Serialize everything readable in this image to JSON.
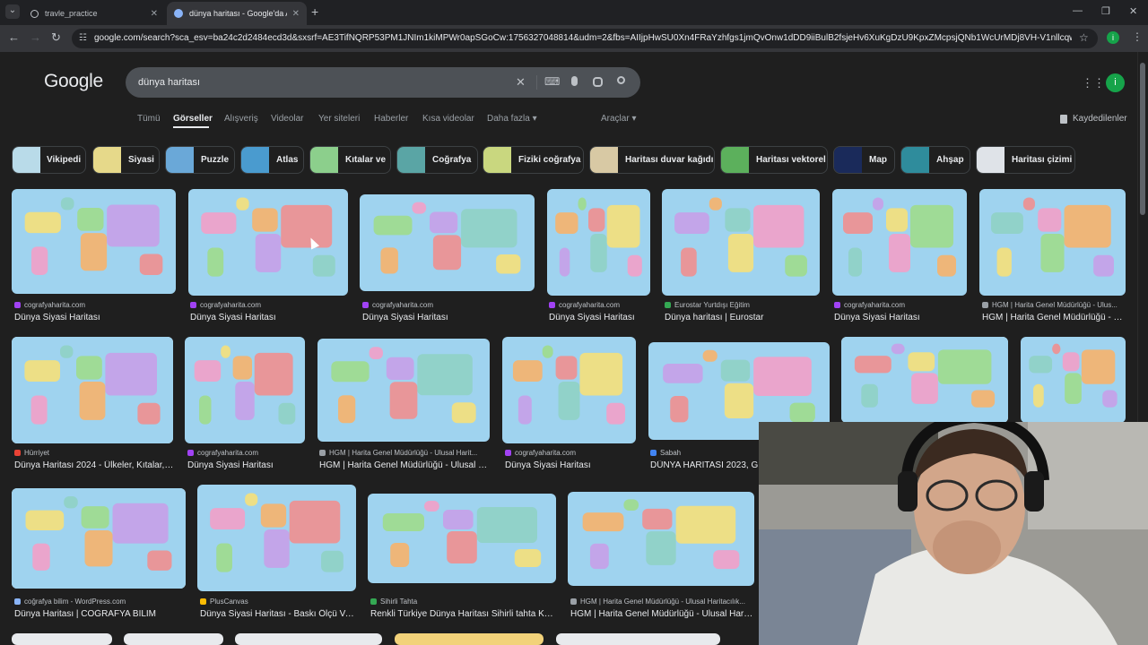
{
  "browser": {
    "tabs": [
      {
        "title": "travle_practice",
        "active": false,
        "icon_color": "#9aa0a6"
      },
      {
        "title": "dünya haritası - Google'da Ara",
        "active": true,
        "icon_color": "#8ab4f8"
      }
    ],
    "new_tab": "+",
    "tab_list_icon": "⌄",
    "url": "google.com/search?sca_esv=ba24c2d2484ecd3d&sxsrf=AE3TifNQRP53PM1JNIm1kiMPWr0apSGoCw:1756327048814&udm=2&fbs=AIIjpHwSU0Xn4FRaYzhfgs1jmQvOnw1dDD9iiBulB2fsjeHv6XuKgDzU9KpxZMcpsjQNb1WcUrMDj8VH-V1nllcqw593rjExNwSikh37NM...",
    "window_controls": [
      "—",
      "❐",
      "✕"
    ],
    "nav_icons": [
      "←",
      "→",
      "↻"
    ],
    "profile_initial": "i"
  },
  "google": {
    "logo": "Google",
    "query": "dünya haritası",
    "nav_tabs": [
      "Tümü",
      "Görseller",
      "Alışveriş",
      "Videolar",
      "Yer siteleri",
      "Haberler",
      "Kısa videolar",
      "Daha fazla ▾"
    ],
    "tools": "Araçlar ▾",
    "saved": "Kaydedilenler",
    "avatar": "i",
    "chips": [
      "Vikipedi",
      "Siyasi",
      "Puzzle",
      "Atlas",
      "Kıtalar ve",
      "Coğrafya",
      "Fiziki coğrafya",
      "Haritası duvar kağıdı",
      "Haritası vektorel",
      "Map",
      "Ahşap",
      "Haritası çizimi"
    ],
    "results": [
      {
        "source": "cografyaharita.com",
        "title": "Dünya Siyasi Haritası",
        "fav": "#a142f4"
      },
      {
        "source": "cografyaharita.com",
        "title": "Dünya Siyasi Haritası",
        "fav": "#a142f4"
      },
      {
        "source": "cografyaharita.com",
        "title": "Dünya Siyasi Haritası",
        "fav": "#a142f4"
      },
      {
        "source": "cografyaharita.com",
        "title": "Dünya Siyasi Haritası",
        "fav": "#a142f4"
      },
      {
        "source": "Eurostar Yurtdışı Eğitim",
        "title": "Dünya haritası | Eurostar",
        "fav": "#34a853"
      },
      {
        "source": "cografyaharita.com",
        "title": "Dünya Siyasi Haritası",
        "fav": "#a142f4"
      },
      {
        "source": "HGM | Harita Genel Müdürlüğü - Ulus...",
        "title": "HGM | Harita Genel Müdürlüğü - U...",
        "fav": "#9aa0a6"
      },
      {
        "source": "Hürriyet",
        "title": "Dünya Haritası 2024 - Ülkeler, Kıtalar, ...",
        "fav": "#ea4335"
      },
      {
        "source": "cografyaharita.com",
        "title": "Dünya Siyasi Haritası",
        "fav": "#a142f4"
      },
      {
        "source": "HGM | Harita Genel Müdürlüğü - Ulusal Harit...",
        "title": "HGM | Harita Genel Müdürlüğü - Ulusal H...",
        "fav": "#9aa0a6"
      },
      {
        "source": "cografyaharita.com",
        "title": "Dünya Siyasi Haritası",
        "fav": "#a142f4"
      },
      {
        "source": "Sabah",
        "title": "DÜNYA HARİTASI 2023, Ge",
        "fav": "#4285f4"
      },
      {
        "source": "coğrafya bilim - WordPress.com",
        "title": "Dünya Haritası | COĞRAFYA BİLİM",
        "fav": "#8ab4f8"
      },
      {
        "source": "PlusCanvas",
        "title": "Dünya Siyasi Haritası - Baskı Ölçü Ve...",
        "fav": "#fbbc04"
      },
      {
        "source": "Sihirli Tahta",
        "title": "Renkli Türkiye Dünya Haritası Sihirli tahta Ka...",
        "fav": "#34a853"
      },
      {
        "source": "HGM | Harita Genel Müdürlüğü - Ulusal Haritacılık...",
        "title": "HGM | Harita Genel Müdürlüğü - Ulusal Harit...",
        "fav": "#9aa0a6"
      }
    ]
  },
  "colors": {
    "page_bg": "#1f1f1f",
    "ocean": "#9fd3ef",
    "land": [
      "#f5e07a",
      "#f2a0c8",
      "#9fdc8c",
      "#f6b26b",
      "#c6a0e8",
      "#ef8f8f",
      "#8fd1c4"
    ]
  }
}
